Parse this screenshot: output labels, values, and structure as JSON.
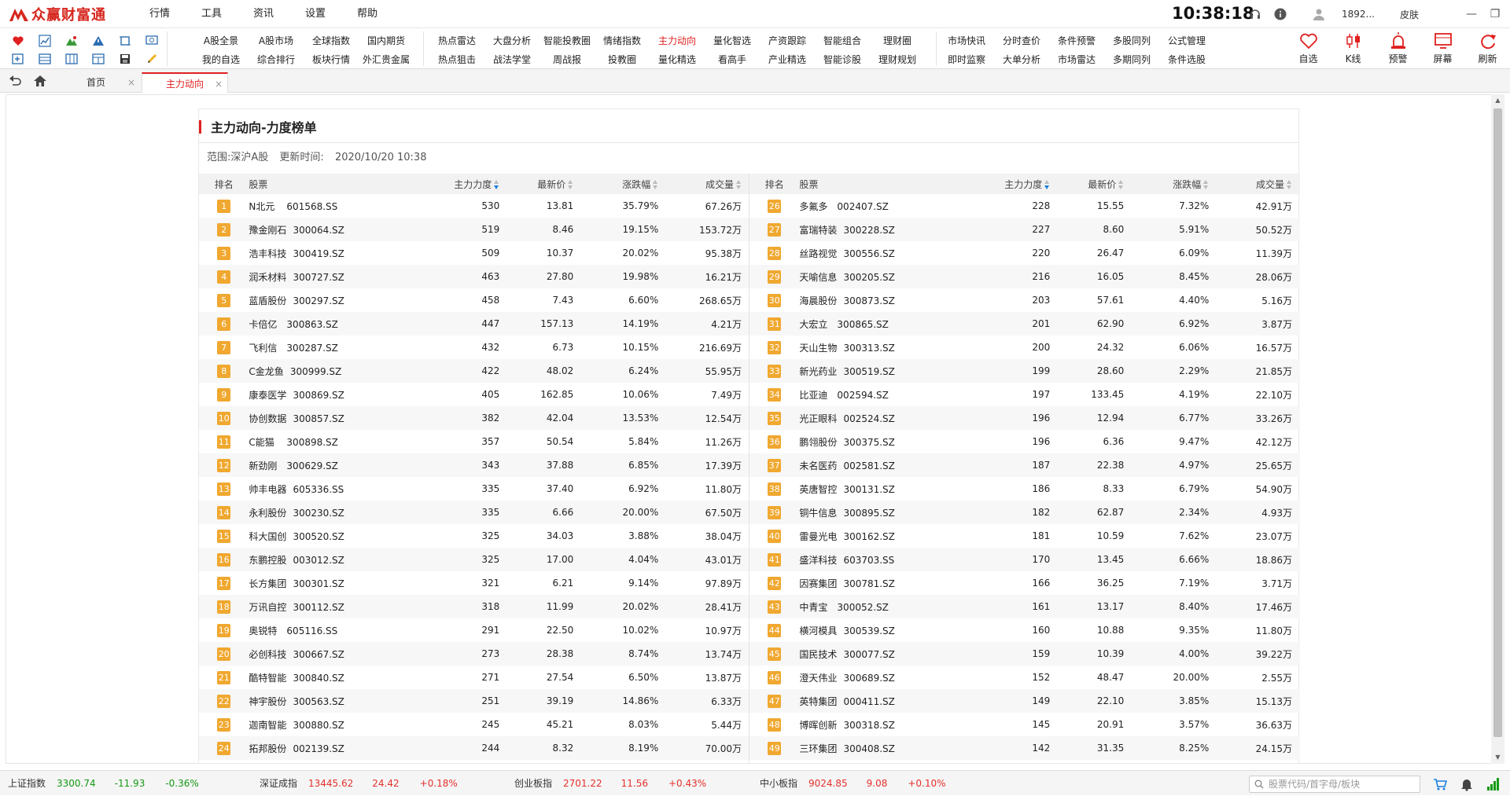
{
  "app": {
    "logo_text": "众赢财富通",
    "menu": [
      "行情",
      "工具",
      "资讯",
      "设置",
      "帮助"
    ],
    "clock": "10:38:18",
    "user": "1892...",
    "skin": "皮肤"
  },
  "functions": [
    [
      "A股全景",
      "我的自选"
    ],
    [
      "A股市场",
      "综合排行"
    ],
    [
      "全球指数",
      "板块行情"
    ],
    [
      "国内期货",
      "外汇贵金属"
    ],
    [
      "热点雷达",
      "热点狙击"
    ],
    [
      "大盘分析",
      "战法学堂"
    ],
    [
      "智能投教圈",
      "周战报"
    ],
    [
      "情绪指数",
      "投教圈"
    ],
    [
      "主力动向",
      "量化精选"
    ],
    [
      "量化智选",
      "看高手"
    ],
    [
      "产资跟踪",
      "产业精选"
    ],
    [
      "智能组合",
      "智能诊股"
    ],
    [
      "理财圈",
      "理财规划"
    ],
    [
      "市场快讯",
      "即时监察"
    ],
    [
      "分时查价",
      "大单分析"
    ],
    [
      "条件预警",
      "市场雷达"
    ],
    [
      "多股同列",
      "多期同列"
    ],
    [
      "公式管理",
      "条件选股"
    ]
  ],
  "active_function": "主力动向",
  "big_tools": [
    "自选",
    "K线",
    "预警",
    "屏幕",
    "刷新"
  ],
  "tabs": [
    {
      "label": "首页"
    },
    {
      "label": "主力动向"
    }
  ],
  "panel": {
    "title": "主力动向-力度榜单",
    "scope": "范围:深沪A股",
    "update_label": "更新时间:",
    "update_time": "2020/10/20 10:38"
  },
  "columns": [
    "排名",
    "股票",
    "主力力度",
    "最新价",
    "涨跌幅",
    "成交量"
  ],
  "rows_left": [
    {
      "rank": "1",
      "name": "N北元",
      "code": "601568.SS",
      "force": "530",
      "price": "13.81",
      "change": "35.79%",
      "volume": "67.26万"
    },
    {
      "rank": "2",
      "name": "豫金刚石",
      "code": "300064.SZ",
      "force": "519",
      "price": "8.46",
      "change": "19.15%",
      "volume": "153.72万"
    },
    {
      "rank": "3",
      "name": "浩丰科技",
      "code": "300419.SZ",
      "force": "509",
      "price": "10.37",
      "change": "20.02%",
      "volume": "95.38万"
    },
    {
      "rank": "4",
      "name": "润禾材料",
      "code": "300727.SZ",
      "force": "463",
      "price": "27.80",
      "change": "19.98%",
      "volume": "16.21万"
    },
    {
      "rank": "5",
      "name": "蓝盾股份",
      "code": "300297.SZ",
      "force": "458",
      "price": "7.43",
      "change": "6.60%",
      "volume": "268.65万"
    },
    {
      "rank": "6",
      "name": "卡倍亿",
      "code": "300863.SZ",
      "force": "447",
      "price": "157.13",
      "change": "14.19%",
      "volume": "4.21万"
    },
    {
      "rank": "7",
      "name": "飞利信",
      "code": "300287.SZ",
      "force": "432",
      "price": "6.73",
      "change": "10.15%",
      "volume": "216.69万"
    },
    {
      "rank": "8",
      "name": "C金龙鱼",
      "code": "300999.SZ",
      "force": "422",
      "price": "48.02",
      "change": "6.24%",
      "volume": "55.95万"
    },
    {
      "rank": "9",
      "name": "康泰医学",
      "code": "300869.SZ",
      "force": "405",
      "price": "162.85",
      "change": "10.06%",
      "volume": "7.49万"
    },
    {
      "rank": "10",
      "name": "协创数据",
      "code": "300857.SZ",
      "force": "382",
      "price": "42.04",
      "change": "13.53%",
      "volume": "12.54万"
    },
    {
      "rank": "11",
      "name": "C能猫",
      "code": "300898.SZ",
      "force": "357",
      "price": "50.54",
      "change": "5.84%",
      "volume": "11.26万"
    },
    {
      "rank": "12",
      "name": "新劲刚",
      "code": "300629.SZ",
      "force": "343",
      "price": "37.88",
      "change": "6.85%",
      "volume": "17.39万"
    },
    {
      "rank": "13",
      "name": "帅丰电器",
      "code": "605336.SS",
      "force": "335",
      "price": "37.40",
      "change": "6.92%",
      "volume": "11.80万"
    },
    {
      "rank": "14",
      "name": "永利股份",
      "code": "300230.SZ",
      "force": "335",
      "price": "6.66",
      "change": "20.00%",
      "volume": "67.50万"
    },
    {
      "rank": "15",
      "name": "科大国创",
      "code": "300520.SZ",
      "force": "325",
      "price": "34.03",
      "change": "3.88%",
      "volume": "38.04万"
    },
    {
      "rank": "16",
      "name": "东鹏控股",
      "code": "003012.SZ",
      "force": "325",
      "price": "17.00",
      "change": "4.04%",
      "volume": "43.01万"
    },
    {
      "rank": "17",
      "name": "长方集团",
      "code": "300301.SZ",
      "force": "321",
      "price": "6.21",
      "change": "9.14%",
      "volume": "97.89万"
    },
    {
      "rank": "18",
      "name": "万讯自控",
      "code": "300112.SZ",
      "force": "318",
      "price": "11.99",
      "change": "20.02%",
      "volume": "28.41万"
    },
    {
      "rank": "19",
      "name": "奥锐特",
      "code": "605116.SS",
      "force": "291",
      "price": "22.50",
      "change": "10.02%",
      "volume": "10.97万"
    },
    {
      "rank": "20",
      "name": "必创科技",
      "code": "300667.SZ",
      "force": "273",
      "price": "28.38",
      "change": "8.74%",
      "volume": "13.74万"
    },
    {
      "rank": "21",
      "name": "酷特智能",
      "code": "300840.SZ",
      "force": "271",
      "price": "27.54",
      "change": "6.50%",
      "volume": "13.87万"
    },
    {
      "rank": "22",
      "name": "神宇股份",
      "code": "300563.SZ",
      "force": "251",
      "price": "39.19",
      "change": "14.86%",
      "volume": "6.33万"
    },
    {
      "rank": "23",
      "name": "迦南智能",
      "code": "300880.SZ",
      "force": "245",
      "price": "45.21",
      "change": "8.03%",
      "volume": "5.44万"
    },
    {
      "rank": "24",
      "name": "拓邦股份",
      "code": "002139.SZ",
      "force": "244",
      "price": "8.32",
      "change": "8.19%",
      "volume": "70.00万"
    }
  ],
  "rows_right": [
    {
      "rank": "26",
      "name": "多氟多",
      "code": "002407.SZ",
      "force": "228",
      "price": "15.55",
      "change": "7.32%",
      "volume": "42.91万"
    },
    {
      "rank": "27",
      "name": "富瑞特装",
      "code": "300228.SZ",
      "force": "227",
      "price": "8.60",
      "change": "5.91%",
      "volume": "50.52万"
    },
    {
      "rank": "28",
      "name": "丝路视觉",
      "code": "300556.SZ",
      "force": "220",
      "price": "26.47",
      "change": "6.09%",
      "volume": "11.39万"
    },
    {
      "rank": "29",
      "name": "天喻信息",
      "code": "300205.SZ",
      "force": "216",
      "price": "16.05",
      "change": "8.45%",
      "volume": "28.06万"
    },
    {
      "rank": "30",
      "name": "海晨股份",
      "code": "300873.SZ",
      "force": "203",
      "price": "57.61",
      "change": "4.40%",
      "volume": "5.16万"
    },
    {
      "rank": "31",
      "name": "大宏立",
      "code": "300865.SZ",
      "force": "201",
      "price": "62.90",
      "change": "6.92%",
      "volume": "3.87万"
    },
    {
      "rank": "32",
      "name": "天山生物",
      "code": "300313.SZ",
      "force": "200",
      "price": "24.32",
      "change": "6.06%",
      "volume": "16.57万"
    },
    {
      "rank": "33",
      "name": "新光药业",
      "code": "300519.SZ",
      "force": "199",
      "price": "28.60",
      "change": "2.29%",
      "volume": "21.85万"
    },
    {
      "rank": "34",
      "name": "比亚迪",
      "code": "002594.SZ",
      "force": "197",
      "price": "133.45",
      "change": "4.19%",
      "volume": "22.10万"
    },
    {
      "rank": "35",
      "name": "光正眼科",
      "code": "002524.SZ",
      "force": "196",
      "price": "12.94",
      "change": "6.77%",
      "volume": "33.26万"
    },
    {
      "rank": "36",
      "name": "鹏翎股份",
      "code": "300375.SZ",
      "force": "196",
      "price": "6.36",
      "change": "9.47%",
      "volume": "42.12万"
    },
    {
      "rank": "37",
      "name": "未名医药",
      "code": "002581.SZ",
      "force": "187",
      "price": "22.38",
      "change": "4.97%",
      "volume": "25.65万"
    },
    {
      "rank": "38",
      "name": "英唐智控",
      "code": "300131.SZ",
      "force": "186",
      "price": "8.33",
      "change": "6.79%",
      "volume": "54.90万"
    },
    {
      "rank": "39",
      "name": "铜牛信息",
      "code": "300895.SZ",
      "force": "182",
      "price": "62.87",
      "change": "2.34%",
      "volume": "4.93万"
    },
    {
      "rank": "40",
      "name": "雷曼光电",
      "code": "300162.SZ",
      "force": "181",
      "price": "10.59",
      "change": "7.62%",
      "volume": "23.07万"
    },
    {
      "rank": "41",
      "name": "盛洋科技",
      "code": "603703.SS",
      "force": "170",
      "price": "13.45",
      "change": "6.66%",
      "volume": "18.86万"
    },
    {
      "rank": "42",
      "name": "因赛集团",
      "code": "300781.SZ",
      "force": "166",
      "price": "36.25",
      "change": "7.19%",
      "volume": "3.71万"
    },
    {
      "rank": "43",
      "name": "中青宝",
      "code": "300052.SZ",
      "force": "161",
      "price": "13.17",
      "change": "8.40%",
      "volume": "17.46万"
    },
    {
      "rank": "44",
      "name": "横河模具",
      "code": "300539.SZ",
      "force": "160",
      "price": "10.88",
      "change": "9.35%",
      "volume": "11.80万"
    },
    {
      "rank": "45",
      "name": "国民技术",
      "code": "300077.SZ",
      "force": "159",
      "price": "10.39",
      "change": "4.00%",
      "volume": "39.22万"
    },
    {
      "rank": "46",
      "name": "澄天伟业",
      "code": "300689.SZ",
      "force": "152",
      "price": "48.47",
      "change": "20.00%",
      "volume": "2.55万"
    },
    {
      "rank": "47",
      "name": "英特集团",
      "code": "000411.SZ",
      "force": "149",
      "price": "22.10",
      "change": "3.85%",
      "volume": "15.13万"
    },
    {
      "rank": "48",
      "name": "博晖创新",
      "code": "300318.SZ",
      "force": "145",
      "price": "20.91",
      "change": "3.57%",
      "volume": "36.63万"
    },
    {
      "rank": "49",
      "name": "三环集团",
      "code": "300408.SZ",
      "force": "142",
      "price": "31.35",
      "change": "8.25%",
      "volume": "24.15万"
    }
  ],
  "indices": [
    {
      "name": "上证指数",
      "value": "3300.74",
      "delta": "-11.93",
      "pct": "-0.36%",
      "trend": "down"
    },
    {
      "name": "深证成指",
      "value": "13445.62",
      "delta": "24.42",
      "pct": "+0.18%",
      "trend": "up"
    },
    {
      "name": "创业板指",
      "value": "2701.22",
      "delta": "11.56",
      "pct": "+0.43%",
      "trend": "up"
    },
    {
      "name": "中小板指",
      "value": "9024.85",
      "delta": "9.08",
      "pct": "+0.10%",
      "trend": "up"
    }
  ],
  "search": {
    "placeholder": "股票代码/首字母/板块"
  },
  "colors": {
    "accent": "#e02020",
    "rank_badge": "#f0a830",
    "up": "#e5302c",
    "down": "#149a14",
    "sort_active": "#1a7fe0"
  }
}
